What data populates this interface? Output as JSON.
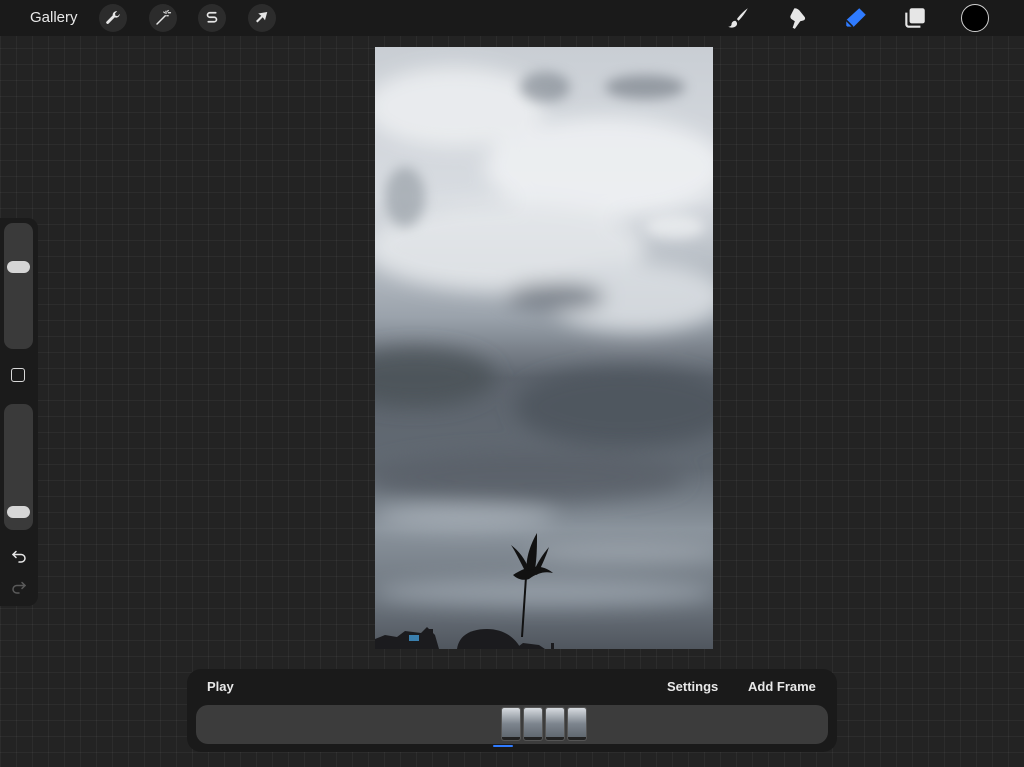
{
  "topbar": {
    "gallery_label": "Gallery",
    "left_tools": [
      {
        "name": "actions-wrench-icon"
      },
      {
        "name": "adjustments-magic-wand-icon"
      },
      {
        "name": "selection-s-icon"
      },
      {
        "name": "transform-arrow-icon"
      }
    ],
    "right_tools": [
      {
        "name": "paintbrush-icon",
        "active": false
      },
      {
        "name": "smudge-icon",
        "active": false
      },
      {
        "name": "eraser-icon",
        "active": true
      },
      {
        "name": "layers-icon",
        "active": false
      }
    ],
    "current_color": "#000000",
    "accent_color": "#2f7bff"
  },
  "sidebar": {
    "brush_size_level": 0.68,
    "opacity_level": 0.08,
    "icons": [
      "modify-square-icon",
      "undo-icon",
      "redo-icon"
    ]
  },
  "animation": {
    "play_label": "Play",
    "settings_label": "Settings",
    "add_frame_label": "Add Frame",
    "frame_count": 4,
    "selected_frame": 1
  }
}
